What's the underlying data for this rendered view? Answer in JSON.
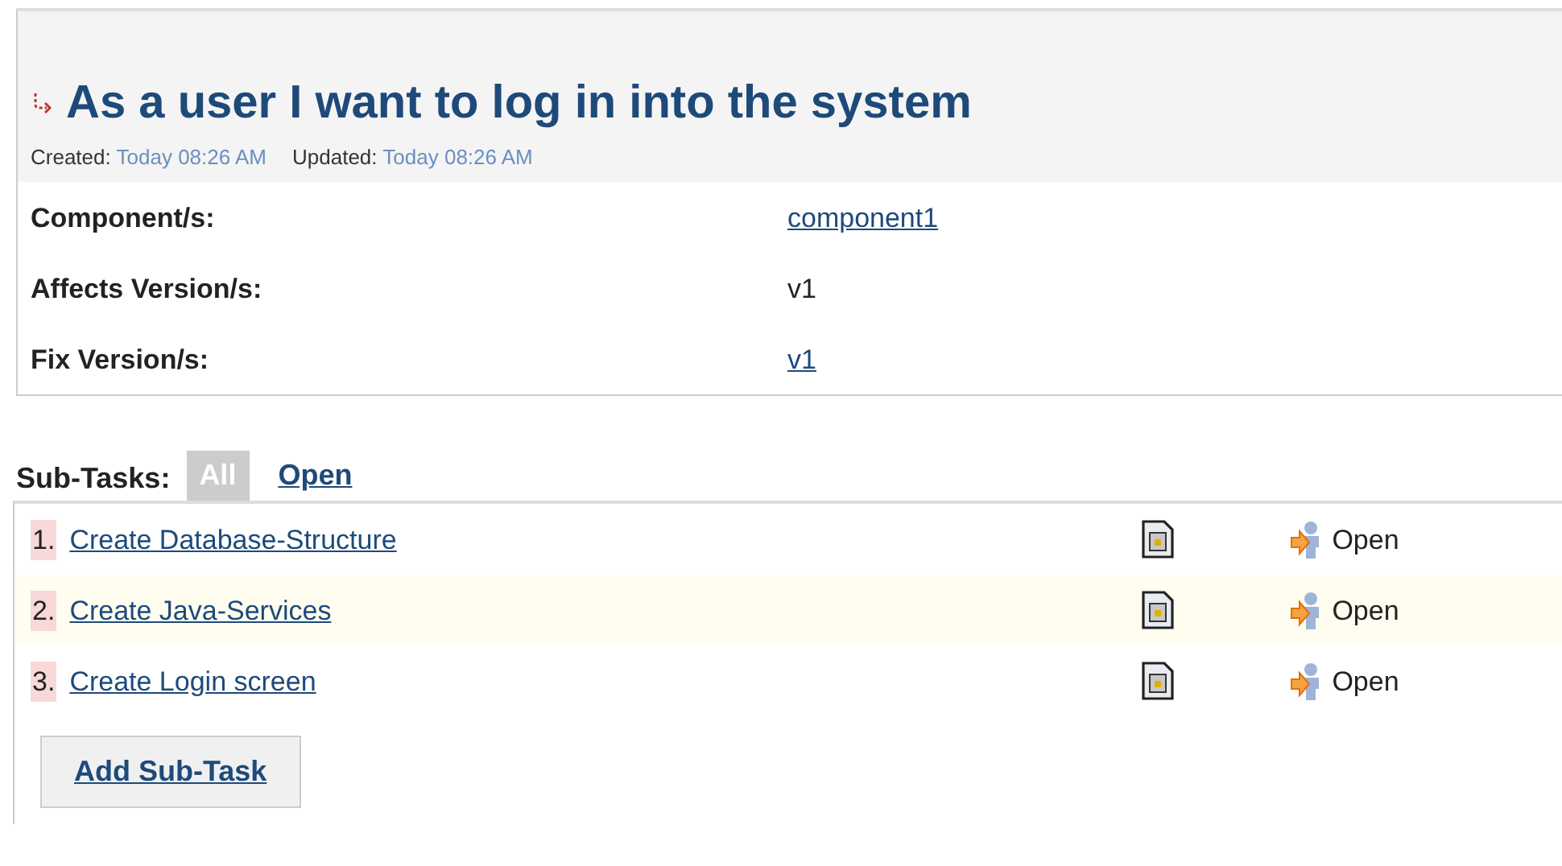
{
  "issue": {
    "title": "As a user I want to log in into the system",
    "dates": [
      {
        "label": "Created:",
        "value": "Today 08:26 AM"
      },
      {
        "label": "Updated:",
        "value": "Today 08:26 AM"
      }
    ]
  },
  "fields": [
    {
      "label": "Component/s:",
      "value": "component1",
      "kind": "link"
    },
    {
      "label": "Affects Version/s:",
      "value": "v1",
      "kind": "text"
    },
    {
      "label": "Fix Version/s:",
      "value": "v1",
      "kind": "link"
    }
  ],
  "subtasks": {
    "label": "Sub-Tasks",
    "separator": ":",
    "filters": [
      {
        "label": "All",
        "selected": true
      },
      {
        "label": "Open",
        "selected": false
      }
    ],
    "rows": [
      {
        "number": "1.",
        "title": "Create Database-Structure",
        "status": "Open",
        "highlighted": false
      },
      {
        "number": "2.",
        "title": "Create Java-Services",
        "status": "Open",
        "highlighted": true
      },
      {
        "number": "3.",
        "title": "Create Login screen",
        "status": "Open",
        "highlighted": false
      }
    ],
    "add_button": "Add Sub-Task"
  }
}
